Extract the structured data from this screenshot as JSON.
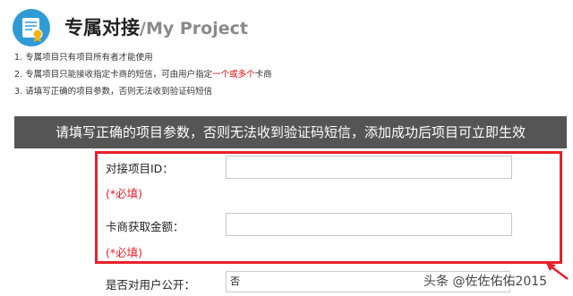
{
  "header": {
    "title": "专属对接",
    "subtitle": "/My Project",
    "icon": "certificate-icon"
  },
  "notes": [
    "1. 专属项目只有项目所有者才能使用",
    "2. 专属项目只能接收指定卡商的短信，可由用户指定",
    "3. 请填写正确的项目参数，否则无法收到验证码短信"
  ],
  "note2_highlight": "一个或多个",
  "note2_tail": "卡商",
  "banner": "请填写正确的项目参数，否则无法收到验证码短信，添加成功后项目可立即生效",
  "form": {
    "project_id_label": "对接项目ID：",
    "project_id_value": "",
    "required_1": "(*必填)",
    "amount_label": "卡商获取金额：",
    "amount_value": "",
    "required_2": "(*必填)",
    "public_label": "是否对用户公开：",
    "public_value": "否"
  },
  "watermark": "头条 @佐佐佑佑2015",
  "colors": {
    "accent": "#e8202a",
    "banner_bg": "#555555",
    "icon_bg": "#2e9bd6"
  }
}
